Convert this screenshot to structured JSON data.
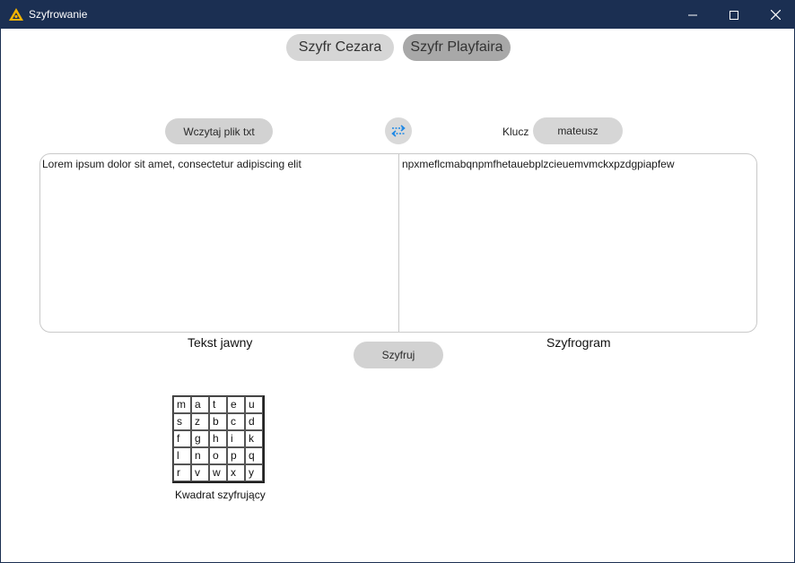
{
  "window": {
    "title": "Szyfrowanie",
    "icons": {
      "app": "app-triangle-icon",
      "minimize": "minimize-icon",
      "maximize": "maximize-icon",
      "close": "close-icon"
    }
  },
  "tabs": [
    {
      "label": "Szyfr Cezara",
      "selected": false
    },
    {
      "label": "Szyfr Playfaira",
      "selected": true
    }
  ],
  "controls": {
    "load_button": "Wczytaj plik txt",
    "swap_icon": "swap-arrows-icon",
    "key_label": "Klucz",
    "key_value": "mateusz",
    "encrypt_button": "Szyfruj"
  },
  "texts": {
    "plain": "Lorem ipsum dolor sit amet, consectetur adipiscing elit",
    "cipher": "npxmeflcmabqnpmfhetauebplzcieuemvmckxpzdgpiapfew",
    "plain_label": "Tekst jawny",
    "cipher_label": "Szyfrogram"
  },
  "square": {
    "label": "Kwadrat szyfrujący",
    "rows": [
      [
        "m",
        "a",
        "t",
        "e",
        "u"
      ],
      [
        "s",
        "z",
        "b",
        "c",
        "d"
      ],
      [
        "f",
        "g",
        "h",
        "i",
        "k"
      ],
      [
        "l",
        "n",
        "o",
        "p",
        "q"
      ],
      [
        "r",
        "v",
        "w",
        "x",
        "y"
      ]
    ]
  },
  "colors": {
    "titlebar": "#1b2f52",
    "tab_selected": "#a8a8a8",
    "tab_default": "#d6d6d6",
    "swap_accent": "#1e88e5"
  }
}
